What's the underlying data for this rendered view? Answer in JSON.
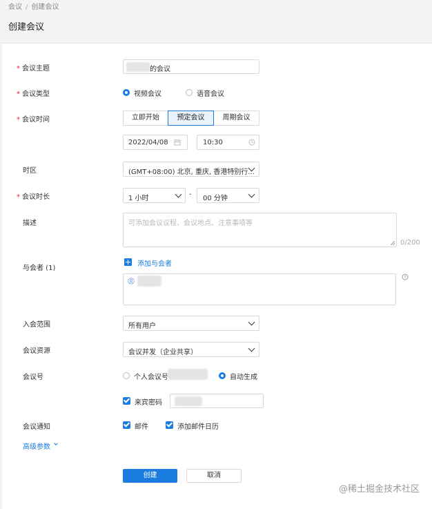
{
  "breadcrumb": {
    "parent": "会议",
    "separator": "/",
    "current": "创建会议"
  },
  "page_title": "创建会议",
  "form": {
    "subject": {
      "label": "会议主题",
      "value_suffix": "的会议"
    },
    "type": {
      "label": "会议类型",
      "options": [
        "视频会议",
        "语音会议"
      ],
      "selected": "视频会议"
    },
    "time": {
      "label": "会议时间",
      "modes": [
        "立即开始",
        "预定会议",
        "周期会议"
      ],
      "selected_mode": "预定会议",
      "date": "2022/04/08",
      "clock": "10:30"
    },
    "timezone": {
      "label": "时区",
      "value": "(GMT+08:00) 北京, 重庆, 香港特别行..."
    },
    "duration": {
      "label": "会议时长",
      "hours": "1 小时",
      "dash": "-",
      "minutes": "00 分钟"
    },
    "description": {
      "label": "描述",
      "placeholder": "可添加会议议程、会议地点、注意事项等",
      "counter": "0/200"
    },
    "attendees": {
      "label": "与会者 (1)",
      "add_label": "添加与会者"
    },
    "join_scope": {
      "label": "入会范围",
      "value": "所有用户"
    },
    "resource": {
      "label": "会议资源",
      "value": "会议并发（企业共享）"
    },
    "meeting_id": {
      "label": "会议号",
      "options": [
        "个人会议号",
        "自动生成"
      ],
      "selected": "自动生成"
    },
    "guest_password": {
      "label": "来宾密码",
      "checked": true
    },
    "notify": {
      "label": "会议通知",
      "options": [
        "邮件",
        "添加邮件日历"
      ]
    },
    "advanced": {
      "label": "高级参数"
    }
  },
  "actions": {
    "create": "创建",
    "cancel": "取消"
  },
  "watermark": "@稀土掘金技术社区",
  "colors": {
    "accent": "#1b7ce0",
    "required": "#e0242d"
  }
}
